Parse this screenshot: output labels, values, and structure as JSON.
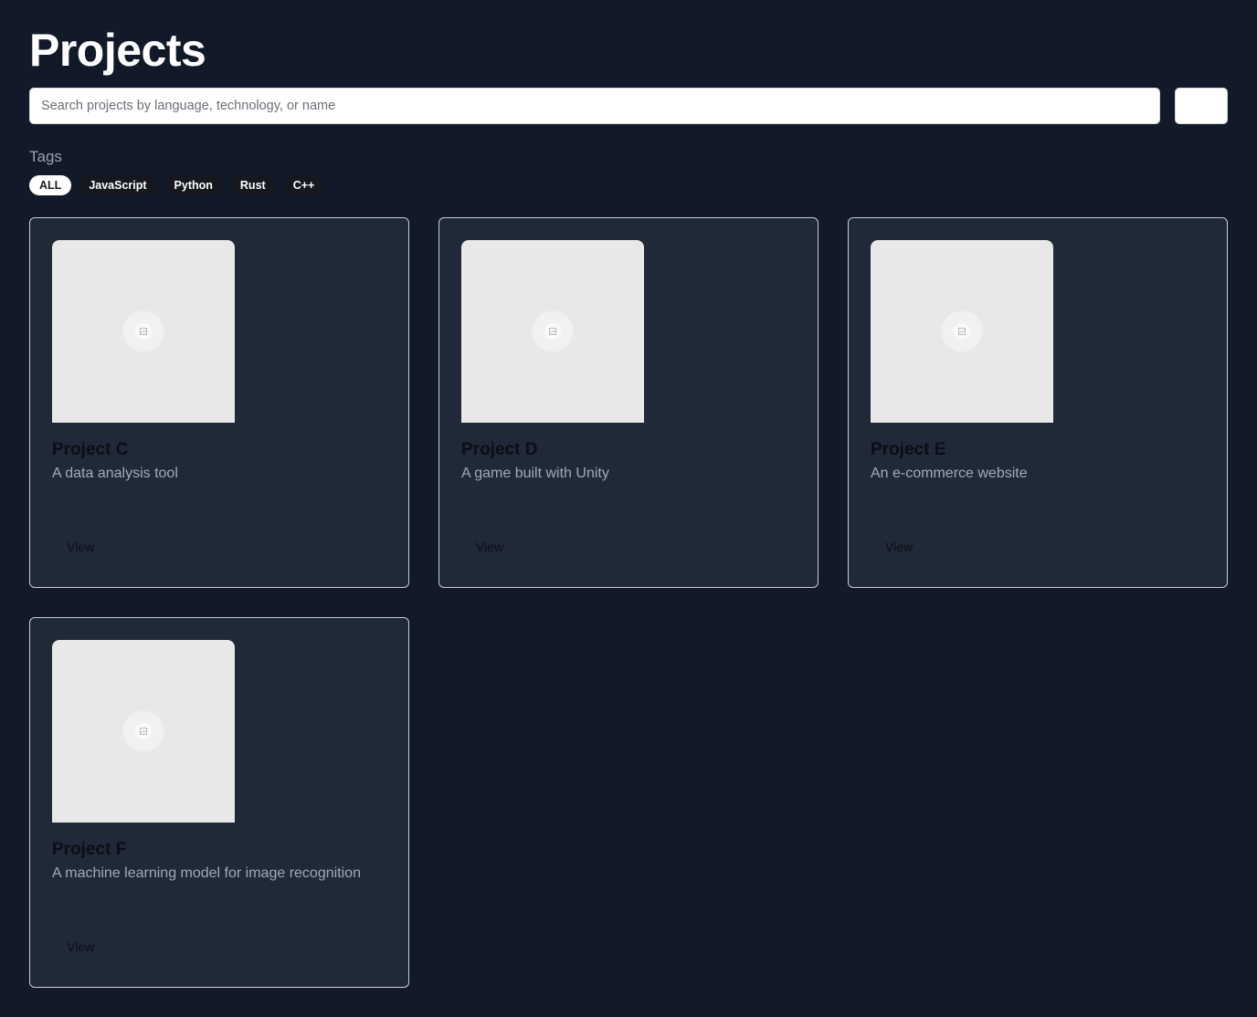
{
  "page": {
    "title": "Projects"
  },
  "search": {
    "placeholder": "Search projects by language, technology, or name",
    "value": "",
    "button_label": ""
  },
  "tags": {
    "label": "Tags",
    "items": [
      {
        "label": "ALL",
        "active": true
      },
      {
        "label": "JavaScript",
        "active": false
      },
      {
        "label": "Python",
        "active": false
      },
      {
        "label": "Rust",
        "active": false
      },
      {
        "label": "C++",
        "active": false
      }
    ]
  },
  "projects": [
    {
      "title": "Project C",
      "description": "A data analysis tool",
      "action": "View"
    },
    {
      "title": "Project D",
      "description": "A game built with Unity",
      "action": "View"
    },
    {
      "title": "Project E",
      "description": "An e-commerce website",
      "action": "View"
    },
    {
      "title": "Project F",
      "description": "A machine learning model for image recognition",
      "action": "View"
    }
  ],
  "colors": {
    "background": "#121a29",
    "card_background": "#202938",
    "card_border": "#c9ced6",
    "tag_background": "#161820",
    "tag_active_background": "#ffffff",
    "thumbnail_placeholder": "#e8e8e8"
  },
  "icons": {
    "thumbnail": "image-placeholder-icon"
  }
}
